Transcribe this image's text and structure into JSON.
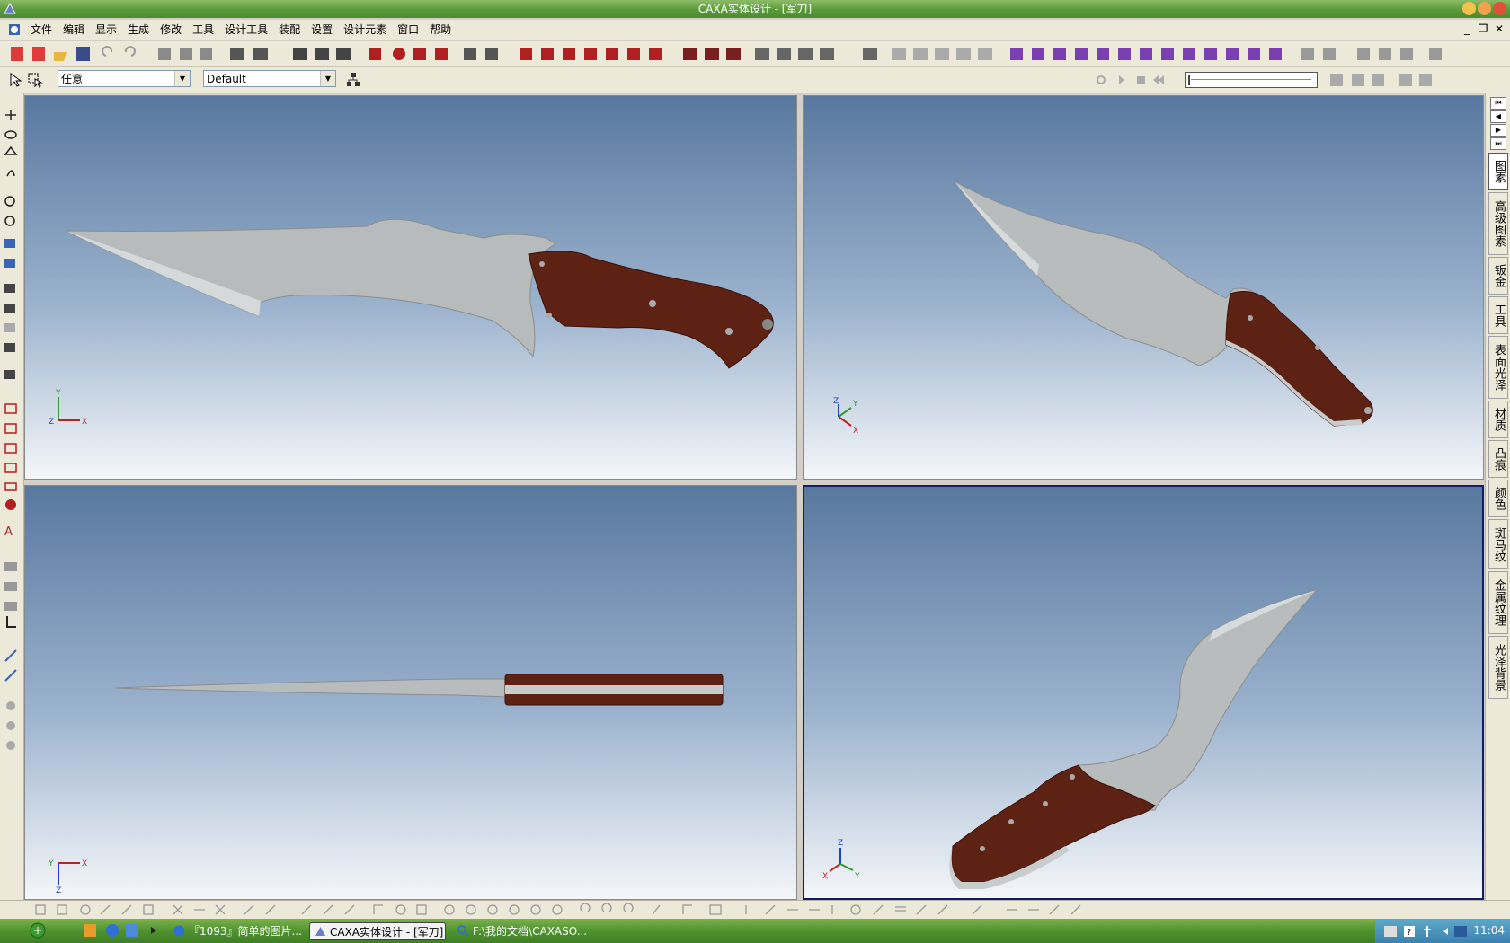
{
  "window": {
    "title": "CAXA实体设计 - [军刀]"
  },
  "menu": {
    "items": [
      "文件",
      "编辑",
      "显示",
      "生成",
      "修改",
      "工具",
      "设计工具",
      "装配",
      "设置",
      "设计元素",
      "窗口",
      "帮助"
    ]
  },
  "toolbar2": {
    "filter_value": "任意",
    "style_value": "Default"
  },
  "right_tabs": {
    "items": [
      "图素",
      "高级图素",
      "钣金",
      "工具",
      "表面光泽",
      "材质",
      "凸痕",
      "颜色",
      "斑马纹",
      "金属纹理",
      "光泽背景"
    ]
  },
  "viewports": {
    "top_left": {
      "axes": [
        "Y",
        "Z",
        "X"
      ]
    },
    "top_right": {
      "axes": [
        "Z",
        "Y",
        "X"
      ]
    },
    "bottom_left": {
      "axes": [
        "Y",
        "X",
        "Z"
      ]
    },
    "bottom_right": {
      "axes": [
        "Z",
        "X",
        "Y"
      ]
    }
  },
  "taskbar": {
    "buttons": [
      "『1093』简单的图片...",
      "CAXA实体设计 - [军刀]",
      "F:\\我的文档\\CAXASO..."
    ],
    "clock": "11:04"
  },
  "colors": {
    "title_green": "#5a9a3c",
    "handle_wood": "#5e2214",
    "blade_steel": "#b9bcbc",
    "viewport_top": "#58789f",
    "viewport_bottom": "#f4f6f9"
  }
}
